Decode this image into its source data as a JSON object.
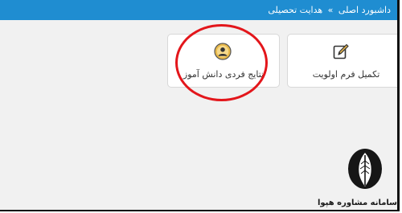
{
  "breadcrumb": {
    "home": "داشبورد اصلی",
    "separator": "»",
    "current": "هدایت تحصیلی"
  },
  "cards": [
    {
      "label": "تکمیل فرم اولویت",
      "icon": "edit-pencil-icon"
    },
    {
      "label": "نتایج فردی دانش آموز",
      "icon": "student-avatar-icon"
    }
  ],
  "watermark": {
    "text": "سامانه مشاوره هپوا"
  },
  "colors": {
    "topbar": "#1f8dd1",
    "highlight": "#e3161b",
    "background": "#f1f1f1"
  }
}
